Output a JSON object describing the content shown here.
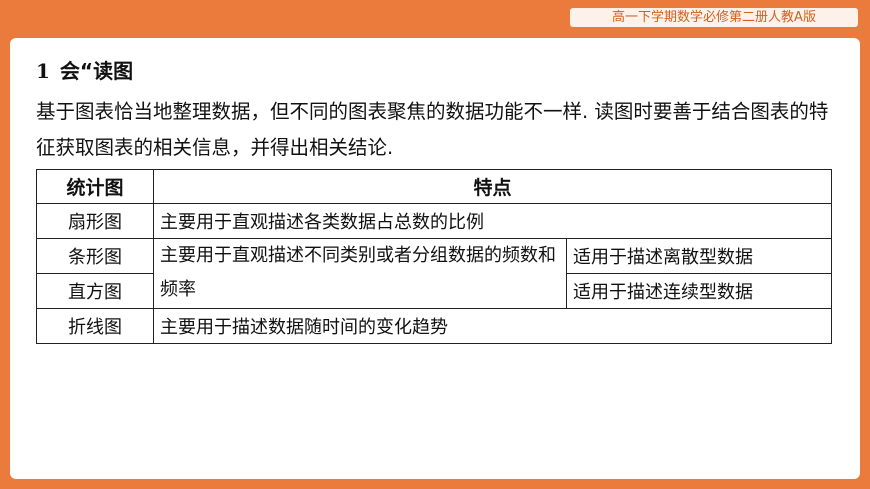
{
  "header": {
    "tag": "高一下学期数学必修第二册人教A版"
  },
  "section": {
    "number": "1",
    "title": "会“读图",
    "paragraph": "基于图表恰当地整理数据，但不同的图表聚焦的数据功能不一样. 读图时要善于结合图表的特征获取图表的相关信息，并得出相关结论."
  },
  "table": {
    "headers": [
      "统计图",
      "特点"
    ],
    "rows": [
      {
        "name": "扇形图",
        "desc": "主要用于直观描述各类数据占总数的比例"
      },
      {
        "name": "条形图",
        "common": "主要用于直观描述不同类别或者分组数据的频数和频率",
        "desc": "适用于描述离散型数据"
      },
      {
        "name": "直方图",
        "desc": "适用于描述连续型数据"
      },
      {
        "name": "折线图",
        "desc": "主要用于描述数据随时间的变化趋势"
      }
    ]
  }
}
